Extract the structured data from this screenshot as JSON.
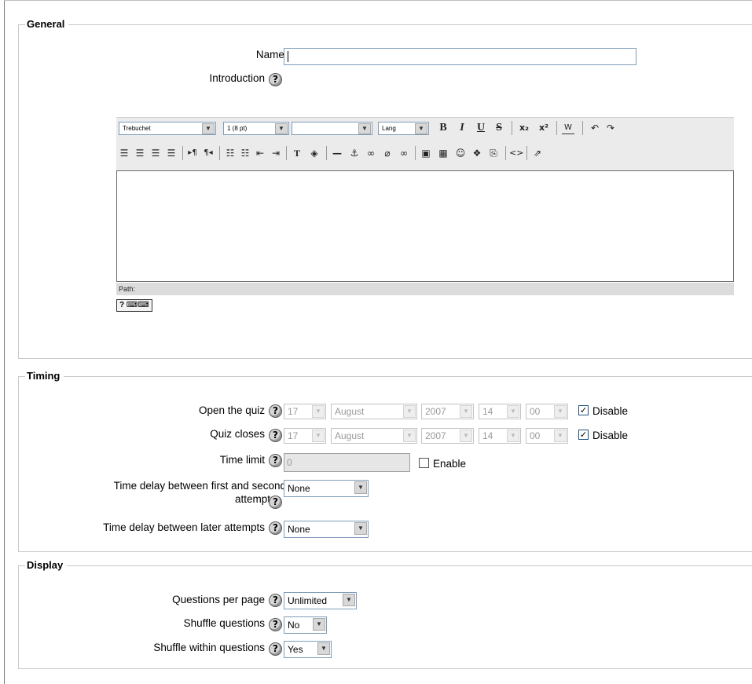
{
  "sections": {
    "general": "General",
    "timing": "Timing",
    "display": "Display"
  },
  "help_icon": "?",
  "general": {
    "name_label": "Name",
    "required_mark": "*",
    "name_value": "",
    "introduction_label": "Introduction"
  },
  "editor": {
    "font_family": "Trebuchet",
    "font_size": "1 (8 pt)",
    "format": "",
    "lang": "Lang",
    "path_label": "Path:",
    "icons_row1": [
      "bold-icon",
      "italic-icon",
      "underline-icon",
      "strikethrough-icon",
      "subscript-icon",
      "superscript-icon",
      "paste-word-icon",
      "undo-icon",
      "redo-icon"
    ],
    "icons_row2": [
      "align-left-icon",
      "align-center-icon",
      "align-right-icon",
      "justify-icon",
      "ltr-icon",
      "rtl-icon",
      "ordered-list-icon",
      "unordered-list-icon",
      "outdent-icon",
      "indent-icon",
      "text-color-icon",
      "background-color-icon",
      "horizontal-rule-icon",
      "anchor-icon",
      "link-icon",
      "unlink-icon",
      "nolink-icon",
      "image-icon",
      "table-icon",
      "smiley-icon",
      "special-char-icon",
      "search-replace-icon",
      "html-source-icon",
      "fullscreen-icon"
    ]
  },
  "timing": {
    "open_label": "Open the quiz",
    "close_label": "Quiz closes",
    "open": {
      "day": "17",
      "month": "August",
      "year": "2007",
      "hour": "14",
      "minute": "00",
      "disable_label": "Disable",
      "disable_checked": true
    },
    "close": {
      "day": "17",
      "month": "August",
      "year": "2007",
      "hour": "14",
      "minute": "00",
      "disable_label": "Disable",
      "disable_checked": true
    },
    "time_limit_label": "Time limit",
    "time_limit_value": "0",
    "enable_label": "Enable",
    "enable_checked": false,
    "delay1_label_line1": "Time delay between first and second",
    "delay1_label_line2": "attempt",
    "delay1_value": "None",
    "delay2_label": "Time delay between later attempts",
    "delay2_value": "None"
  },
  "display": {
    "questions_per_page_label": "Questions per page",
    "questions_per_page_value": "Unlimited",
    "shuffle_questions_label": "Shuffle questions",
    "shuffle_questions_value": "No",
    "shuffle_within_label": "Shuffle within questions",
    "shuffle_within_value": "Yes"
  },
  "colors": {
    "input_border": "#7f9db9",
    "fieldset_border": "#c9c9c9",
    "toolbar_bg": "#ebebeb"
  }
}
